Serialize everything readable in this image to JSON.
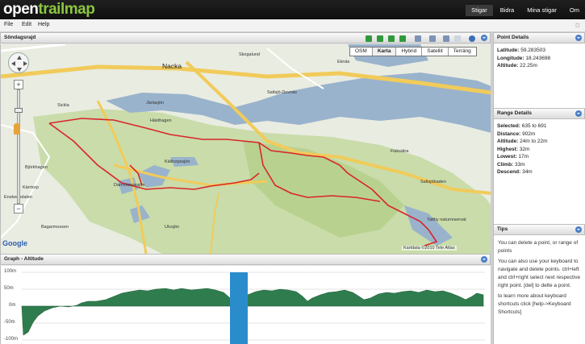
{
  "app": {
    "logo_prefix": "open",
    "logo_suffix": "trailmap",
    "nav": [
      "Stigar",
      "Bidra",
      "Mina stigar",
      "Om"
    ]
  },
  "menu": [
    "File",
    "Edit",
    "Help"
  ],
  "map_panel": {
    "title": "Söndagsrajd",
    "map_types": [
      "OSM",
      "Karta",
      "Hybrid",
      "Satellit",
      "Terräng"
    ],
    "active_map_type": "Karta",
    "copyright": "Kartdata ©2010 Tele Atlas",
    "google": "Google",
    "zoom_in": "+",
    "zoom_out": "−",
    "labels": {
      "nacka": "Nacka",
      "skogalund": "Skogalund",
      "eknas": "Eknäs",
      "saltsjo_duvnas": "Saltsjö-Duvnäs",
      "jarlasjon": "Järlasjön",
      "hasthagen": "Hästhagen",
      "fisksatra": "Fisksätra",
      "saltsjobaden": "Saltsjöbaden",
      "kallvikssjon": "Källtorpssjön",
      "bjorkhagen": "Björkhagen",
      "karrtorp": "Kärrtorp",
      "enskededalen": "Enskededalen",
      "bagarmossen": "Bagarmossen",
      "tattby": "Tattby naturreservat",
      "sickla": "Sickla",
      "dammtorpssjon": "Dammtorpssjön",
      "ulvsjon": "Ulvsjön"
    },
    "road_numbers": [
      "222",
      "222",
      "260",
      "228",
      "228",
      "260",
      "260",
      "73",
      "229",
      "222"
    ]
  },
  "graph_panel": {
    "title": "Graph - Altitude",
    "y_ticks": [
      "100m",
      "50m",
      "0m",
      "-50m",
      "-100m"
    ]
  },
  "point_details": {
    "title": "Point Details",
    "latitude_label": "Latitude:",
    "latitude": "59.283503",
    "longitude_label": "Longitude:",
    "longitude": "18.243698",
    "altitude_label": "Altitude:",
    "altitude": "22.25m"
  },
  "range_details": {
    "title": "Range Details",
    "selected_label": "Selected:",
    "selected": "635 to 691",
    "distance_label": "Distance:",
    "distance": "902m",
    "altitude_label": "Altitude:",
    "altitude": "24m to 22m",
    "highest_label": "Highest:",
    "highest": "32m",
    "lowest_label": "Lowest:",
    "lowest": "17m",
    "climb_label": "Climb:",
    "climb": "33m",
    "descend_label": "Descend:",
    "descend": "34m"
  },
  "tips": {
    "title": "Tips",
    "p1": "You can delete a point, or range of points",
    "p2": "You can also use your keyboard to navigate and delete points. ctrl+left and ctrl+right select next respective right point. [del] to delte a point.",
    "p3": "to learn more about keyboard shortcuts click [help->Keyboard Shortcuts]"
  },
  "colors": {
    "route": "#d9242a",
    "elevation_fill": "#2f7d4e",
    "selection": "#2b8ccc",
    "accent_green": "#8cc63f"
  },
  "icons": [
    "first-icon",
    "prev-icon",
    "next-icon",
    "last-icon",
    "delete-icon",
    "print-icon",
    "satellite-icon",
    "help-icon",
    "gear-icon"
  ]
}
